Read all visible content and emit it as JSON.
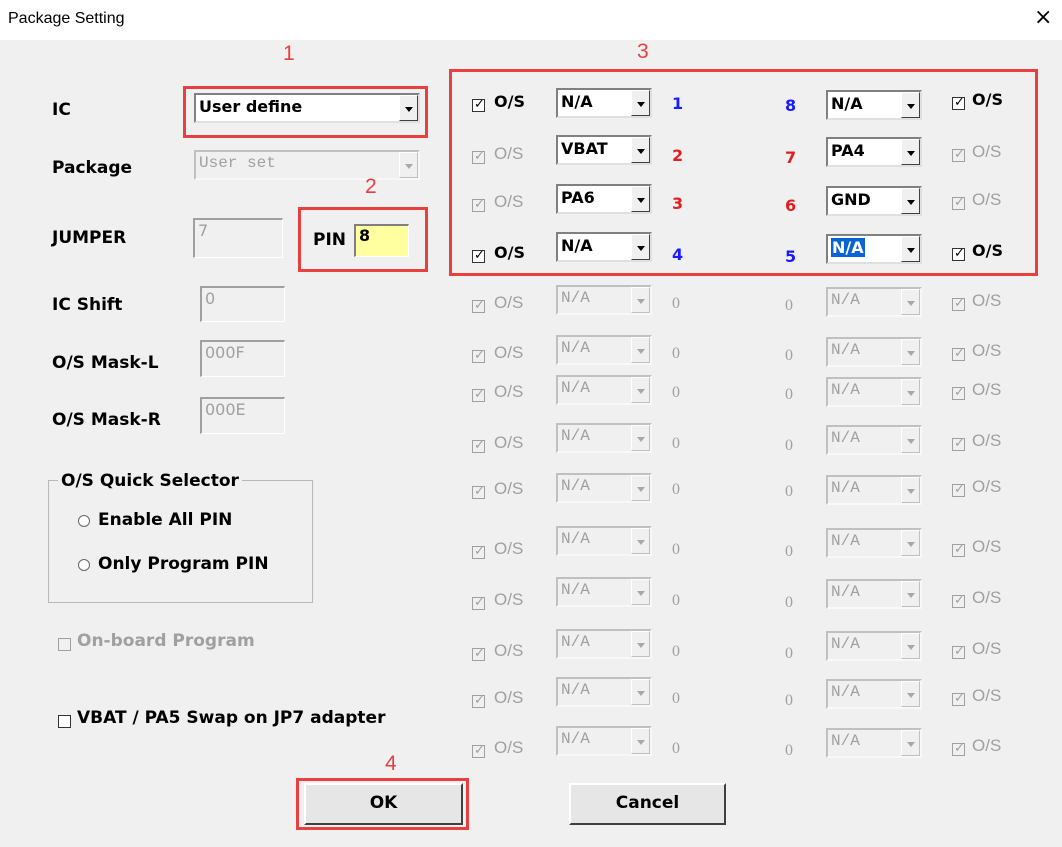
{
  "window": {
    "title": "Package Setting",
    "close_glyph": "×"
  },
  "form": {
    "ic_label": "IC",
    "ic_value": "User define",
    "package_label": "Package",
    "package_value": "User set",
    "jumper_label": "JUMPER",
    "jumper_value": "7",
    "pin_label": "PIN",
    "pin_value": "8",
    "ic_shift_label": "IC Shift",
    "ic_shift_value": "0",
    "os_mask_l_label": "O/S Mask-L",
    "os_mask_l_value": "000F",
    "os_mask_r_label": "O/S Mask-R",
    "os_mask_r_value": "000E"
  },
  "quick_selector": {
    "title": "O/S Quick Selector",
    "enable_all": "Enable All PIN",
    "only_program": "Only Program PIN"
  },
  "onboard_program": "On-board Program",
  "vbat_swap": "VBAT / PA5 Swap on JP7 adapter",
  "buttons": {
    "ok": "OK",
    "cancel": "Cancel"
  },
  "annotations": {
    "box1": "1",
    "box2": "2",
    "box3": "3",
    "box4": "4"
  },
  "os_label": "O/S",
  "pins": [
    {
      "left_os_checked": true,
      "left_os_enabled": true,
      "left_value": "N/A",
      "left_num": "1",
      "left_num_color": "#1a1aff",
      "right_num": "8",
      "right_num_color": "#1a1aff",
      "right_value": "N/A",
      "right_os_checked": true,
      "right_os_enabled": true,
      "enabled": true,
      "right_selected": false
    },
    {
      "left_os_checked": true,
      "left_os_enabled": false,
      "left_value": "VBAT",
      "left_num": "2",
      "left_num_color": "#e02020",
      "right_num": "7",
      "right_num_color": "#e02020",
      "right_value": "PA4",
      "right_os_checked": true,
      "right_os_enabled": false,
      "enabled": true,
      "right_selected": false
    },
    {
      "left_os_checked": true,
      "left_os_enabled": false,
      "left_value": "PA6",
      "left_num": "3",
      "left_num_color": "#e02020",
      "right_num": "6",
      "right_num_color": "#e02020",
      "right_value": "GND",
      "right_os_checked": true,
      "right_os_enabled": false,
      "enabled": true,
      "right_selected": false
    },
    {
      "left_os_checked": true,
      "left_os_enabled": true,
      "left_value": "N/A",
      "left_num": "4",
      "left_num_color": "#1a1aff",
      "right_num": "5",
      "right_num_color": "#1a1aff",
      "right_value": "N/A",
      "right_os_checked": true,
      "right_os_enabled": true,
      "enabled": true,
      "right_selected": true
    },
    {
      "left_os_checked": true,
      "left_os_enabled": false,
      "left_value": "N/A",
      "left_num": "0",
      "right_num": "0",
      "right_value": "N/A",
      "right_os_checked": true,
      "right_os_enabled": false,
      "enabled": false
    },
    {
      "left_os_checked": true,
      "left_os_enabled": false,
      "left_value": "N/A",
      "left_num": "0",
      "right_num": "0",
      "right_value": "N/A",
      "right_os_checked": true,
      "right_os_enabled": false,
      "enabled": false
    },
    {
      "left_os_checked": true,
      "left_os_enabled": false,
      "left_value": "N/A",
      "left_num": "0",
      "right_num": "0",
      "right_value": "N/A",
      "right_os_checked": true,
      "right_os_enabled": false,
      "enabled": false
    },
    {
      "left_os_checked": true,
      "left_os_enabled": false,
      "left_value": "N/A",
      "left_num": "0",
      "right_num": "0",
      "right_value": "N/A",
      "right_os_checked": true,
      "right_os_enabled": false,
      "enabled": false
    },
    {
      "left_os_checked": true,
      "left_os_enabled": false,
      "left_value": "N/A",
      "left_num": "0",
      "right_num": "0",
      "right_value": "N/A",
      "right_os_checked": true,
      "right_os_enabled": false,
      "enabled": false
    },
    {
      "left_os_checked": true,
      "left_os_enabled": false,
      "left_value": "N/A",
      "left_num": "0",
      "right_num": "0",
      "right_value": "N/A",
      "right_os_checked": true,
      "right_os_enabled": false,
      "enabled": false
    },
    {
      "left_os_checked": true,
      "left_os_enabled": false,
      "left_value": "N/A",
      "left_num": "0",
      "right_num": "0",
      "right_value": "N/A",
      "right_os_checked": true,
      "right_os_enabled": false,
      "enabled": false
    },
    {
      "left_os_checked": true,
      "left_os_enabled": false,
      "left_value": "N/A",
      "left_num": "0",
      "right_num": "0",
      "right_value": "N/A",
      "right_os_checked": true,
      "right_os_enabled": false,
      "enabled": false
    },
    {
      "left_os_checked": true,
      "left_os_enabled": false,
      "left_value": "N/A",
      "left_num": "0",
      "right_num": "0",
      "right_value": "N/A",
      "right_os_checked": true,
      "right_os_enabled": false,
      "enabled": false
    },
    {
      "left_os_checked": true,
      "left_os_enabled": false,
      "left_value": "N/A",
      "left_num": "0",
      "right_num": "0",
      "right_value": "N/A",
      "right_os_checked": true,
      "right_os_enabled": false,
      "enabled": false
    }
  ]
}
